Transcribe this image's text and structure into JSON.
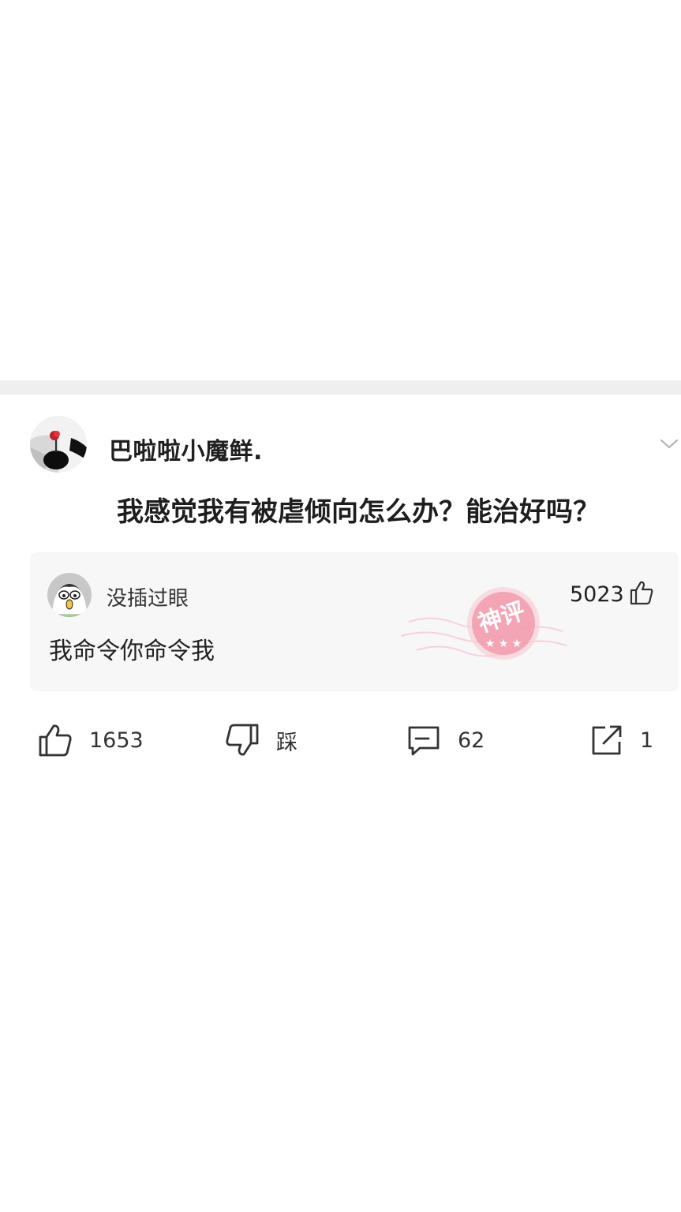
{
  "post": {
    "author_name": "巴啦啦小魔鲜.",
    "title": "我感觉我有被虐倾向怎么办？能治好吗？",
    "god_comment": {
      "commenter_name": "没插过眼",
      "likes": "5023",
      "text": "我命令你命令我",
      "stamp_text": "神评"
    },
    "actions": {
      "like_count": "1653",
      "dislike_label": "踩",
      "comment_count": "62",
      "share_count": "1"
    }
  },
  "colors": {
    "divider": "#efefef",
    "comment_bg": "#f7f7f7",
    "stamp": "#f06b86",
    "text": "#222222"
  },
  "icons": [
    "chevron-down-icon",
    "thumbs-up-icon",
    "thumbs-down-icon",
    "comment-icon",
    "share-icon"
  ]
}
